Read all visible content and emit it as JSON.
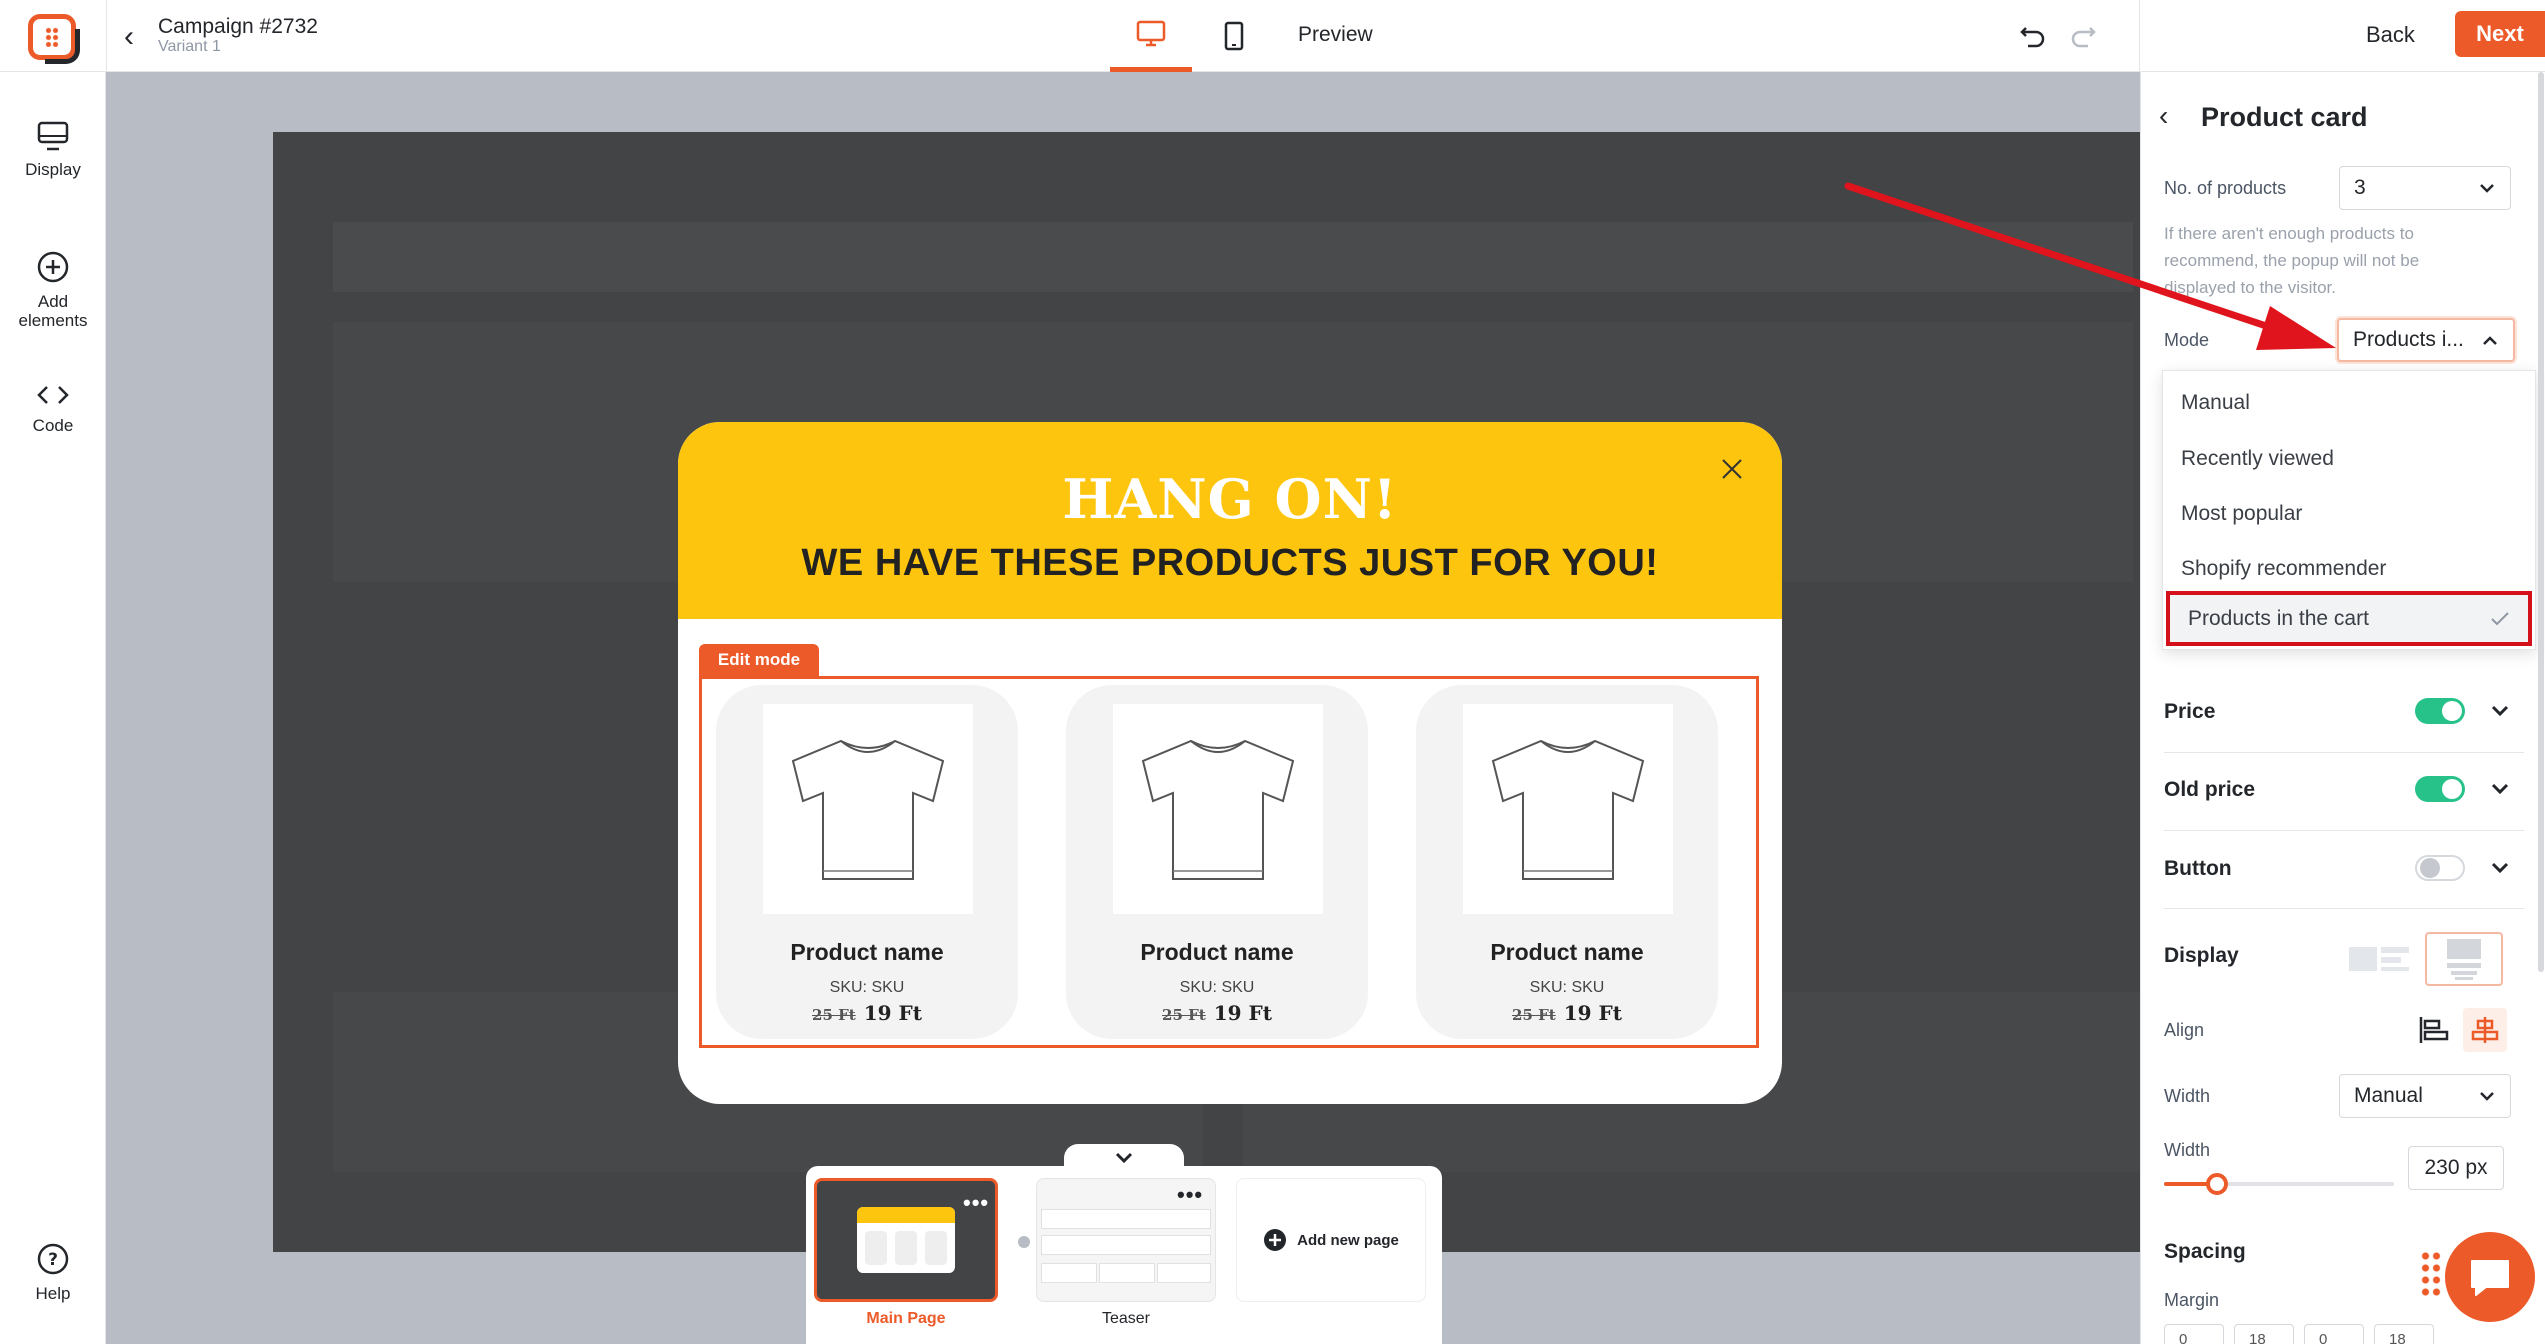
{
  "header": {
    "campaign_title": "Campaign #2732",
    "variant": "Variant 1",
    "preview_label": "Preview",
    "back_label": "Back",
    "next_label": "Next"
  },
  "sidebar": {
    "items": [
      {
        "label": "Display",
        "icon": "monitor-icon"
      },
      {
        "label": "Add elements",
        "icon": "plus-circle-icon"
      },
      {
        "label": "Code",
        "icon": "code-icon"
      },
      {
        "label": "Help",
        "icon": "question-circle-icon"
      }
    ]
  },
  "popup": {
    "headline": "HANG ON!",
    "subheadline": "WE HAVE THESE PRODUCTS JUST FOR YOU!",
    "edit_mode_label": "Edit mode",
    "products": [
      {
        "name": "Product name",
        "sku": "SKU: SKU",
        "old_price": "25 Ft",
        "price": "19 Ft"
      },
      {
        "name": "Product name",
        "sku": "SKU: SKU",
        "old_price": "25 Ft",
        "price": "19 Ft"
      },
      {
        "name": "Product name",
        "sku": "SKU: SKU",
        "old_price": "25 Ft",
        "price": "19 Ft"
      }
    ]
  },
  "pages": {
    "main_label": "Main Page",
    "teaser_label": "Teaser",
    "add_label": "Add new page"
  },
  "panel": {
    "title": "Product card",
    "num_products_label": "No. of products",
    "num_products_value": "3",
    "help_text": "If there aren't enough products to recommend, the popup will not be displayed to the visitor.",
    "mode_label": "Mode",
    "mode_value": "Products i...",
    "mode_options": [
      "Manual",
      "Recently viewed",
      "Most popular",
      "Shopify recommender",
      "Products in the cart"
    ],
    "mode_selected_index": 4,
    "price_label": "Price",
    "price_on": true,
    "old_price_label": "Old price",
    "old_price_on": true,
    "button_label": "Button",
    "button_on": false,
    "display_label": "Display",
    "align_label": "Align",
    "width_mode_label": "Width",
    "width_mode_value": "Manual",
    "width_label": "Width",
    "width_value": "230 px",
    "width_slider_fraction": 0.23,
    "spacing_label": "Spacing",
    "margin_label": "Margin",
    "margin_values": [
      "0",
      "18",
      "0",
      "18"
    ]
  },
  "colors": {
    "accent": "#ed5a29",
    "popup_header": "#fec50f",
    "toggle_on": "#27c28a",
    "highlight_red": "#d4101a"
  }
}
